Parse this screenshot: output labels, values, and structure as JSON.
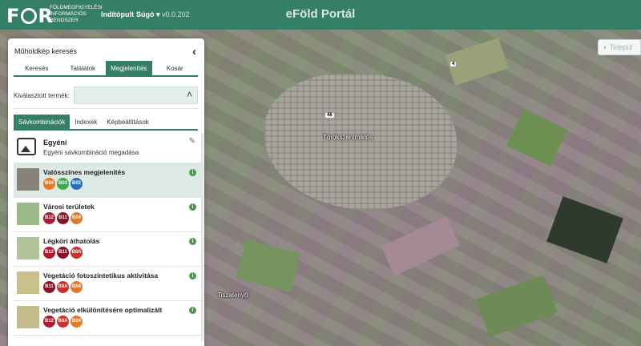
{
  "header": {
    "logo_part1": "F",
    "logo_part2": "R",
    "logo_sub": [
      "FÖLDMEGFIGYELÉSI",
      "INFORMÁCIÓS",
      "RENDSZER"
    ],
    "nav_start": "Indítópult",
    "nav_help": "Súgó ▾",
    "version": "v0.0.202",
    "portal_title": "eFöld Portál"
  },
  "map": {
    "labels": {
      "town": "Törökszentmiklós",
      "village": "Tiszatenyő"
    },
    "road_badges": [
      "4",
      "46"
    ],
    "corner_button": "Települ"
  },
  "panel": {
    "title": "Műholdkép keresés",
    "main_tabs": [
      {
        "label": "Keresés",
        "active": false
      },
      {
        "label": "Találatok",
        "active": false
      },
      {
        "label": "Megjelenítés",
        "active": true
      },
      {
        "label": "Kosár",
        "active": false
      }
    ],
    "product_label": "Kiválasztott termék:",
    "sub_tabs": [
      {
        "label": "Sávkombinációk",
        "active": true
      },
      {
        "label": "Indexek",
        "active": false
      },
      {
        "label": "Képbeállítások",
        "active": false
      }
    ],
    "custom": {
      "title": "Egyéni",
      "description": "Egyéni sávkombináció megadása"
    },
    "combinations": [
      {
        "name": "Valósszínes megjelenítés",
        "selected": true,
        "thumb": "#8a8278",
        "bands": [
          {
            "label": "B04",
            "color": "#e07a2a"
          },
          {
            "label": "B03",
            "color": "#3aaa4a"
          },
          {
            "label": "B02",
            "color": "#2a6fb5"
          }
        ]
      },
      {
        "name": "Városi területek",
        "selected": false,
        "thumb": "#9cb98a",
        "bands": [
          {
            "label": "B12",
            "color": "#b0182e"
          },
          {
            "label": "B11",
            "color": "#8a1226"
          },
          {
            "label": "B04",
            "color": "#e07a2a"
          }
        ]
      },
      {
        "name": "Légköri áthatolás",
        "selected": false,
        "thumb": "#b2c49a",
        "bands": [
          {
            "label": "B12",
            "color": "#b0182e"
          },
          {
            "label": "B11",
            "color": "#8a1226"
          },
          {
            "label": "B8A",
            "color": "#c8322e"
          }
        ]
      },
      {
        "name": "Vegetáció fotoszintetikus aktivitása",
        "selected": false,
        "thumb": "#c9c08a",
        "bands": [
          {
            "label": "B11",
            "color": "#8a1226"
          },
          {
            "label": "B8A",
            "color": "#c8322e"
          },
          {
            "label": "B04",
            "color": "#e07a2a"
          }
        ]
      },
      {
        "name": "Vegetáció elkülönítésére optimalizált",
        "selected": false,
        "thumb": "#c4ba8c",
        "bands": [
          {
            "label": "B12",
            "color": "#b0182e"
          },
          {
            "label": "B8A",
            "color": "#c8322e"
          },
          {
            "label": "B04",
            "color": "#e07a2a"
          }
        ]
      }
    ]
  }
}
